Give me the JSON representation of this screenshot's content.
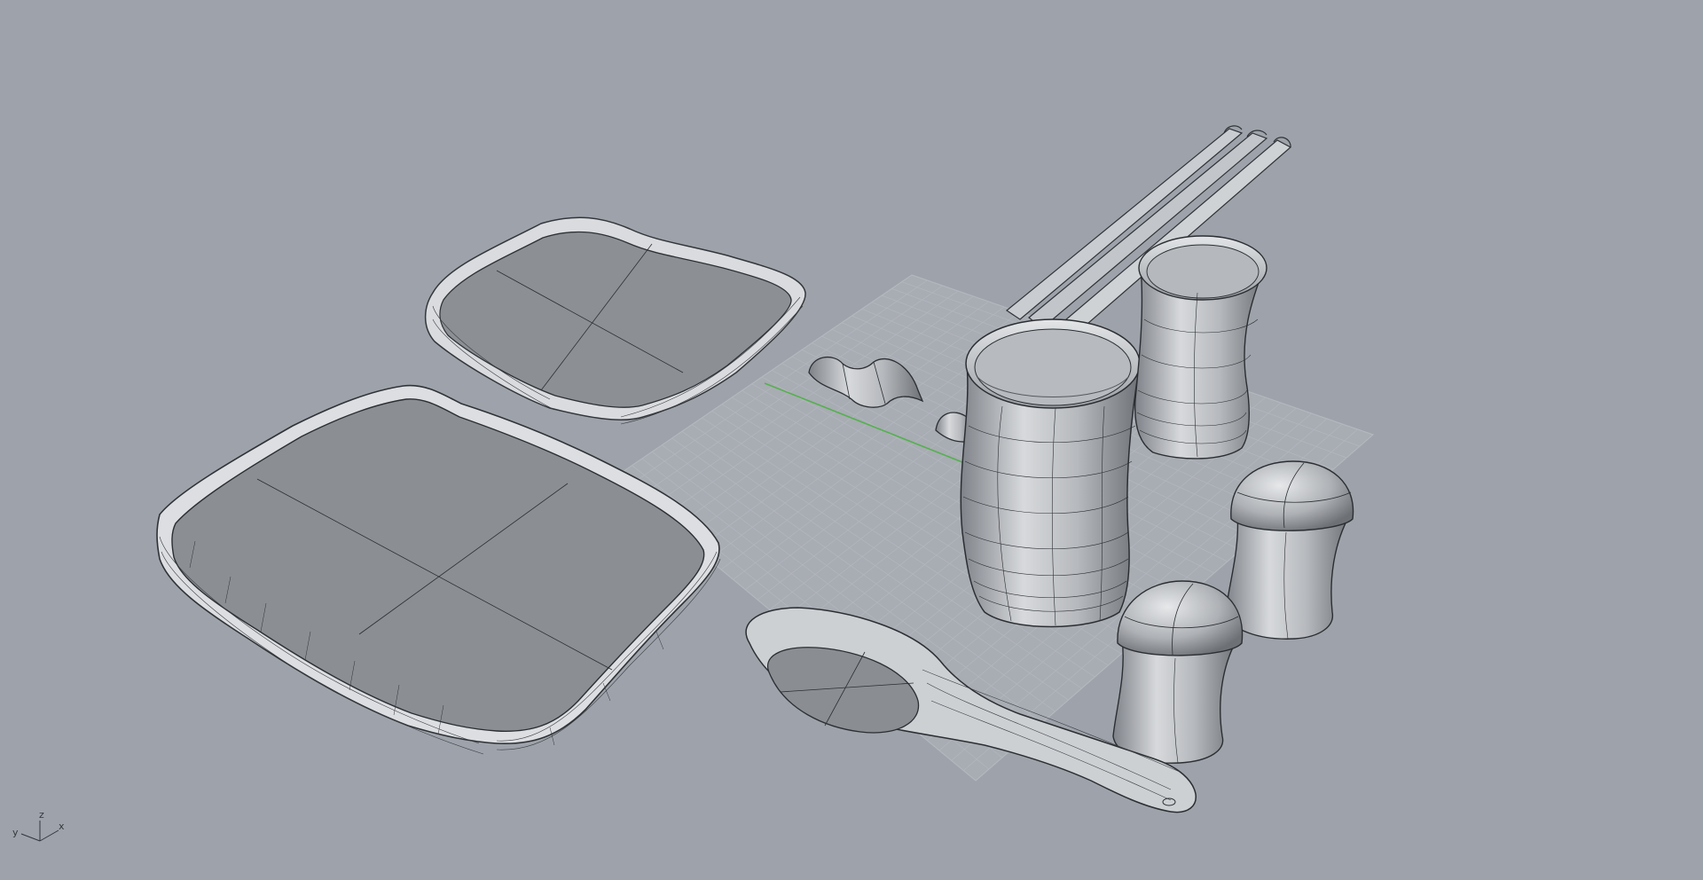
{
  "viewport": {
    "name": "Perspective",
    "display_mode": "shaded",
    "background_color": "#9ea3ab",
    "grid_color": "#b3b7be",
    "x_axis_color": "#55b04f",
    "objects": [
      "large-tray",
      "small-tray",
      "tall-cup",
      "short-cup",
      "salt-shaker",
      "pepper-shaker",
      "spoon",
      "chopsticks",
      "chopstick-rests"
    ]
  },
  "axis_widget": {
    "labels": {
      "y": "y",
      "z": "z",
      "x": "x"
    }
  }
}
